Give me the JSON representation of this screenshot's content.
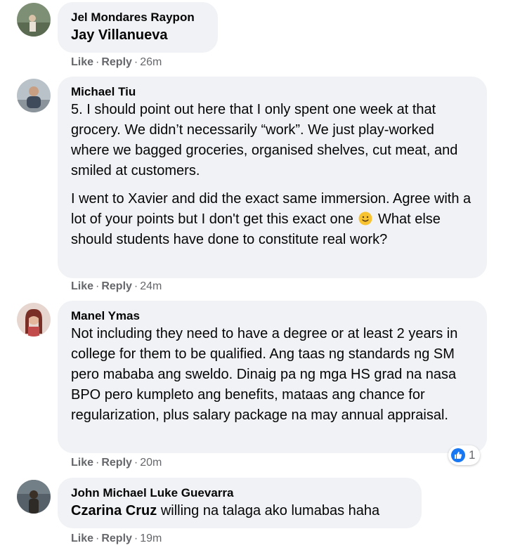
{
  "colors": {
    "bubble": "#f0f2f5",
    "meta_text": "#65676b",
    "like_blue": "#1877f2"
  },
  "actions": {
    "like": "Like",
    "reply": "Reply",
    "dot": "·"
  },
  "comments": [
    {
      "author": "Jel Mondares Raypon",
      "mention": "Jay Villanueva",
      "time": "26m"
    },
    {
      "author": "Michael Tiu",
      "paragraph1": "5. I should point out here that I only spent one week at that grocery. We didn’t necessarily “work”. We just play-worked where we bagged groceries, organised shelves, cut meat, and smiled at customers.",
      "paragraph2_before": "I went to Xavier and did the exact same immersion. Agree with a lot of your points but I don't get this exact one",
      "paragraph2_emoji": "slightly-smiling-face-emoji",
      "paragraph2_after": "What else should students have done to constitute real work?",
      "time": "24m"
    },
    {
      "author": "Manel Ymas",
      "text": "Not including they need to have a degree or at least 2 years in college for them to be qualified. Ang taas ng standards ng SM pero mababa ang sweldo. Dinaig pa ng mga HS grad na nasa BPO pero kumpleto ang benefits, mataas ang chance for regularization, plus salary package na may annual appraisal.",
      "reaction_icon": "like-icon",
      "reaction_count": "1",
      "time": "20m"
    },
    {
      "author": "John Michael Luke Guevarra",
      "mention": "Czarina Cruz",
      "text": "willing na talaga ako lumabas haha",
      "time": "19m"
    }
  ]
}
